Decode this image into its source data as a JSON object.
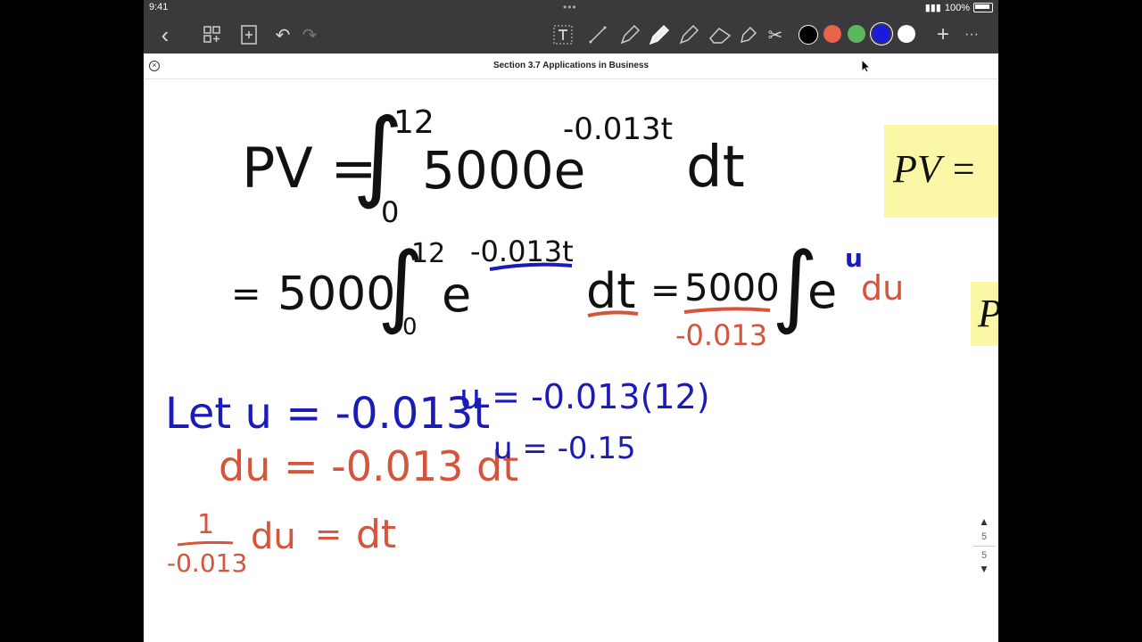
{
  "status": {
    "time": "9:41",
    "battery": "100%"
  },
  "toolbar": {
    "icons": [
      "back-icon",
      "thumbnails-icon",
      "add-page-icon",
      "undo-icon",
      "redo-icon",
      "text-tool-icon",
      "line-icon",
      "pen-icon",
      "highlighter-icon",
      "pencil-icon",
      "eraser-icon",
      "lasso-icon",
      "scissors-icon"
    ],
    "colors": [
      "#000000",
      "#e8634a",
      "#5cb85c",
      "#1a1adb",
      "#ffffff"
    ],
    "selected_color": "#1a1adb",
    "add_label": "+",
    "more_label": "···"
  },
  "document": {
    "title": "Section 3.7 Applications in Business"
  },
  "math": {
    "line1": {
      "lhs": "PV =",
      "integral": "∫",
      "upper": "12",
      "lower": "0",
      "coef": "5000e",
      "exp": "-0.013t",
      "dt": "dt"
    },
    "line2": {
      "eq": "=",
      "coef": "5000",
      "integral": "∫",
      "upper": "12",
      "lower": "0",
      "e": "e",
      "exp": "-0.013t",
      "dt": "dt",
      "eq2": "=",
      "frac_num": "5000",
      "frac_den": "-0.013",
      "integral2": "∫",
      "e2": "e",
      "exp2": "u",
      "du": "du"
    },
    "let": "Let u = -0.013t",
    "u_sub1": "u = -0.013(12)",
    "du_line": "du = -0.013 dt",
    "u_sub2": "u = -0.15",
    "frac_line": {
      "num": "1",
      "den": "-0.013",
      "du": "du",
      "eq": "=",
      "dt": "dt"
    }
  },
  "sticky": {
    "text1": "PV =",
    "text2": "P"
  },
  "pager": {
    "current": "5",
    "total": "5"
  }
}
